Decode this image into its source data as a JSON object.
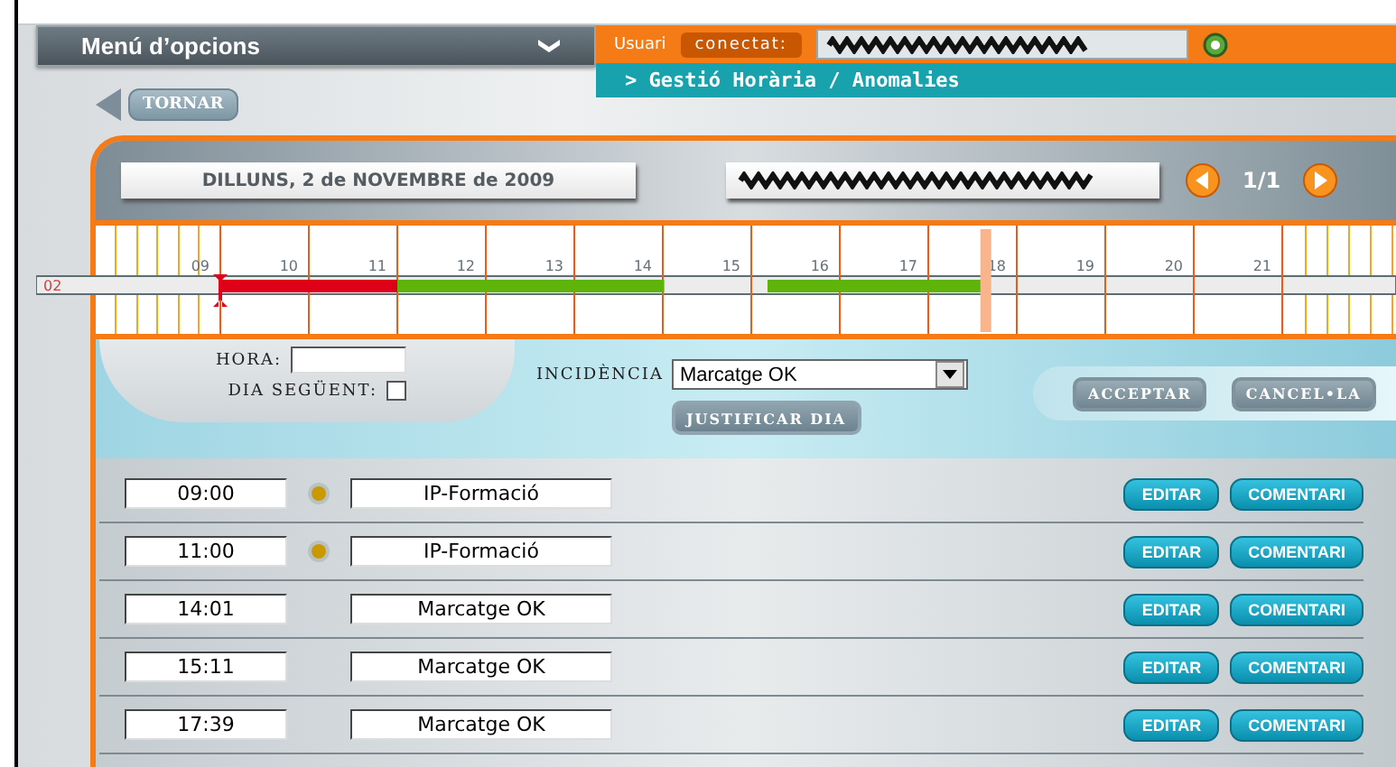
{
  "menu": {
    "label": "Menú d’opcions"
  },
  "user_bar": {
    "user_label": "Usuari",
    "status": "conectat:"
  },
  "breadcrumb": "> Gestió Horària / Anomalies",
  "back_button": "TORNAR",
  "day_header": {
    "date": "DILLUNS, 2 de NOVEMBRE de 2009",
    "page": "1/1"
  },
  "timeline": {
    "row_label": "02",
    "hours": [
      "09",
      "10",
      "11",
      "12",
      "13",
      "14",
      "15",
      "16",
      "17",
      "18",
      "19",
      "20",
      "21"
    ]
  },
  "form": {
    "hora_label": "HORA:",
    "next_day_label": "DIA SEGÜENT:",
    "next_day_checked": false,
    "incidence_label": "INCIDÈNCIA",
    "incidence_value": "Marcatge OK",
    "justify_button": "JUSTIFICAR DIA",
    "buttons": [
      {
        "label": "ACCEPTAR",
        "disabled": true
      },
      {
        "label": "CANCEL•LA",
        "disabled": true
      }
    ]
  },
  "rows": [
    {
      "time": "09:00",
      "alert": true,
      "incidence": "IP-Formació",
      "color": "#dd0018",
      "edit_button": "EDITAR",
      "comment_button": "COMENTARI"
    },
    {
      "time": "11:00",
      "alert": true,
      "incidence": "IP-Formació",
      "color": "#5fb40a",
      "edit_button": "EDITAR",
      "comment_button": "COMENTARI"
    },
    {
      "time": "14:01",
      "alert": false,
      "incidence": "Marcatge OK",
      "edit_button": "EDITAR",
      "comment_button": "COMENTARI"
    },
    {
      "time": "15:11",
      "alert": false,
      "incidence": "Marcatge OK",
      "color": "#5fb40a",
      "edit_button": "EDITAR",
      "comment_button": "COMENTARI"
    },
    {
      "time": "17:39",
      "alert": false,
      "incidence": "Marcatge OK",
      "edit_button": "EDITAR",
      "comment_button": "COMENTARI"
    }
  ]
}
